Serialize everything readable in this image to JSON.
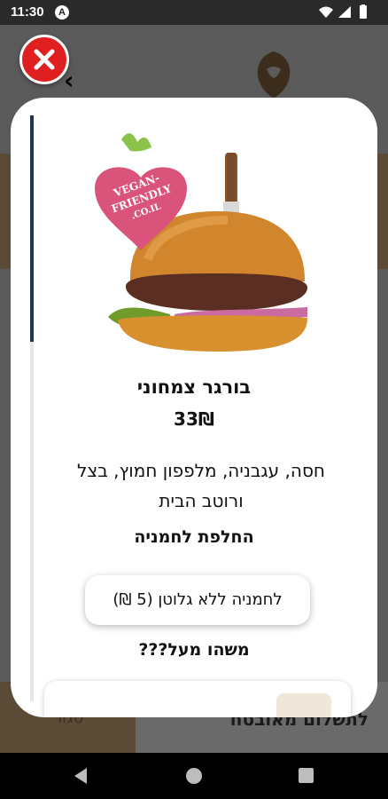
{
  "status_bar": {
    "time": "11:30",
    "accessibility_glyph": "A"
  },
  "background": {
    "bottom_action": "לתשלום מאובטח",
    "bottom_left_text": "סגור"
  },
  "modal": {
    "badge_text": "VEGAN-FRIENDLY.CO.IL",
    "product_title": "בורגר צמחוני",
    "price": "33₪",
    "description": "חסה, עגבניה, מלפפון חמוץ, בצל ורוטב הבית",
    "section_bread": "החלפת לחמניה",
    "option_gluten_free": "לחמניה ללא גלוטן (5 ₪)",
    "section_extra": "משהו מעל???"
  },
  "colors": {
    "close_button": "#e02020",
    "scroll_thumb": "#1d3557",
    "badge_pink": "#d9537a"
  }
}
